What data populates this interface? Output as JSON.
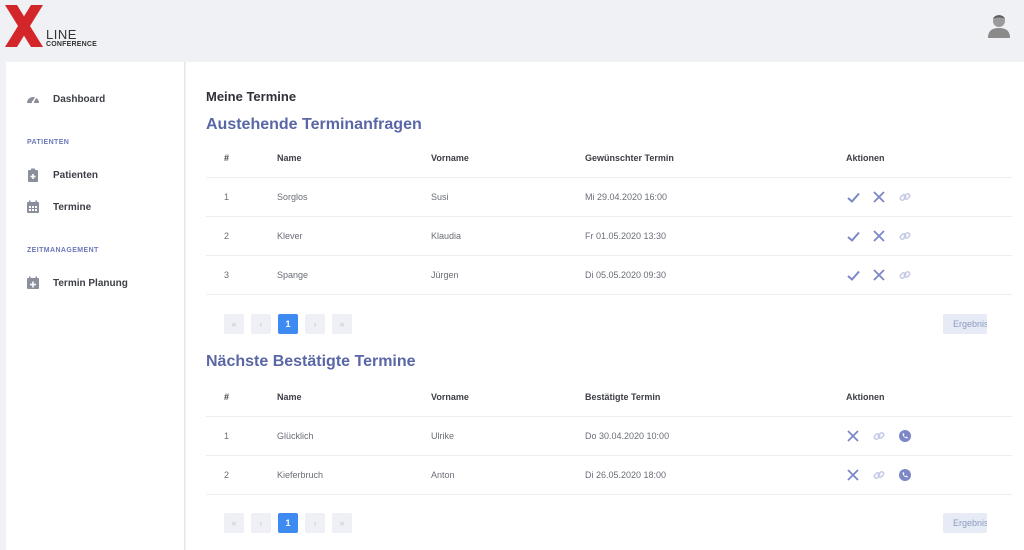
{
  "brand": {
    "letter": "X",
    "line": "LINE",
    "sub": "CONFERENCE",
    "color": "#d3262b"
  },
  "sidebar": {
    "dashboard": "Dashboard",
    "section_patients": "PATIENTEN",
    "patients": "Patienten",
    "appointments": "Termine",
    "section_time": "ZEITMANAGEMENT",
    "planning": "Termin Planung"
  },
  "main": {
    "title": "Meine Termine",
    "pending": {
      "title": "Austehende Terminanfragen",
      "columns": [
        "#",
        "Name",
        "Vorname",
        "Gewünschter Termin",
        "Aktionen"
      ],
      "rows": [
        {
          "num": "1",
          "name": "Sorglos",
          "first": "Susi",
          "date": "Mi 29.04.2020 16:00"
        },
        {
          "num": "2",
          "name": "Klever",
          "first": "Klaudia",
          "date": "Fr 01.05.2020 13:30"
        },
        {
          "num": "3",
          "name": "Spange",
          "first": "Jürgen",
          "date": "Di 05.05.2020 09:30"
        }
      ],
      "pager": {
        "first": "«",
        "prev": "‹",
        "current": "1",
        "next": "›",
        "last": "»"
      },
      "per_page": "Ergebnisse"
    },
    "confirmed": {
      "title": "Nächste Bestätigte Termine",
      "columns": [
        "#",
        "Name",
        "Vorname",
        "Bestätigte Termin",
        "Aktionen"
      ],
      "rows": [
        {
          "num": "1",
          "name": "Glücklich",
          "first": "Ulrike",
          "date": "Do 30.04.2020 10:00"
        },
        {
          "num": "2",
          "name": "Kieferbruch",
          "first": "Anton",
          "date": "Di 26.05.2020 18:00"
        }
      ],
      "pager": {
        "first": "«",
        "prev": "‹",
        "current": "1",
        "next": "›",
        "last": "»"
      },
      "per_page": "Ergebnisse"
    }
  },
  "colors": {
    "accent": "#3d8bf2",
    "heading": "#5a67a6",
    "icon": "#7b87c6"
  }
}
